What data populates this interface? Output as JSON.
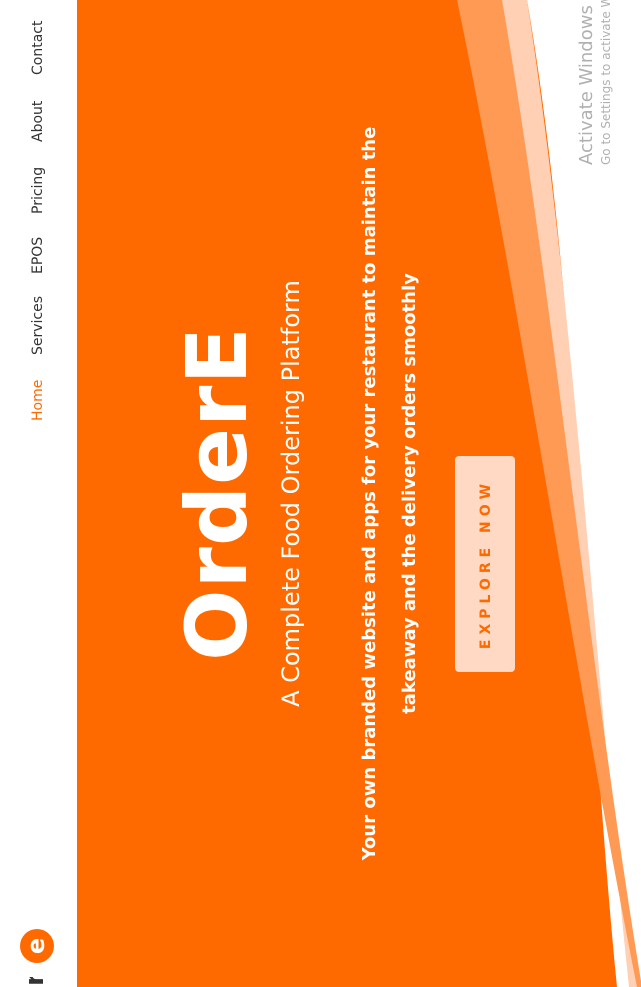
{
  "brand": {
    "logo_letter": "e",
    "logo_text": "r",
    "accent_color": "#ff6a00"
  },
  "nav": {
    "items": [
      {
        "label": "Home",
        "active": true
      },
      {
        "label": "Services",
        "active": false
      },
      {
        "label": "EPOS",
        "active": false
      },
      {
        "label": "Pricing",
        "active": false
      },
      {
        "label": "About",
        "active": false
      },
      {
        "label": "Contact",
        "active": false
      }
    ]
  },
  "hero": {
    "title": "OrderE",
    "subtitle": "A Complete Food Ordering Platform",
    "description_lines": [
      "Your own branded website and apps for your restaurant to maintain the",
      "takeaway and the delivery orders smoothly"
    ],
    "cta_label": "EXPLORE NOW",
    "background_color": "#ff6a00",
    "cta_color": "#ffd9c4"
  },
  "watermark": {
    "title": "Activate Windows",
    "subtitle": "Go to Settings to activate Windows."
  }
}
